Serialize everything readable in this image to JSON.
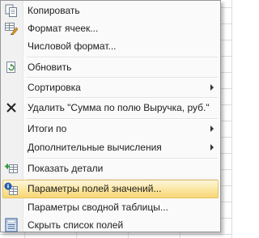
{
  "menu": {
    "copy": {
      "label": "Копировать",
      "icon": "copy-icon"
    },
    "format_cells": {
      "label": "Формат ячеек...",
      "icon": "format-cells-icon"
    },
    "number_format": {
      "label": "Числовой формат..."
    },
    "refresh": {
      "label": "Обновить",
      "icon": "refresh-icon"
    },
    "sort": {
      "label": "Сортировка"
    },
    "remove_field": {
      "label": "Удалить \"Сумма по полю Выручка, руб.\"",
      "icon": "delete-x-icon"
    },
    "summarize_by": {
      "label": "Итоги по"
    },
    "show_values_as": {
      "label": "Дополнительные вычисления"
    },
    "show_details": {
      "label": "Показать детали",
      "icon": "show-details-icon"
    },
    "value_field_settings": {
      "label": "Параметры полей значений...",
      "icon": "field-settings-icon"
    },
    "pivot_options": {
      "label": "Параметры сводной таблицы..."
    },
    "hide_field_list": {
      "label": "Скрыть список полей",
      "icon": "field-list-icon"
    }
  },
  "colors": {
    "hover_border": "#e5c365",
    "hover_fill": "#fbe7a4",
    "text": "#1e1e1e",
    "menu_border": "#979797"
  }
}
